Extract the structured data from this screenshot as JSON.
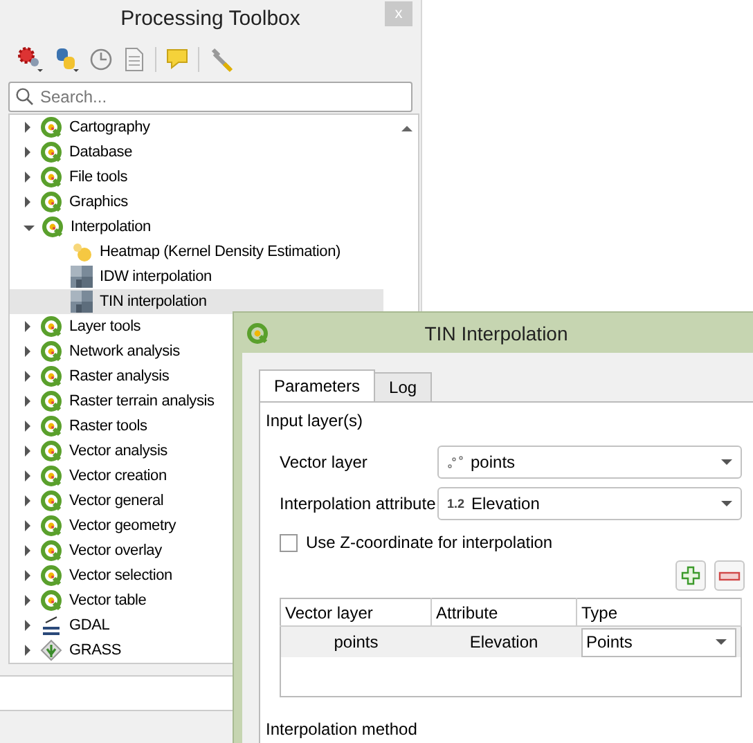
{
  "toolbox": {
    "title": "Processing Toolbox",
    "close": "x",
    "search": {
      "placeholder": "Search..."
    },
    "tree": [
      {
        "label": "Cartography",
        "kind": "qgis",
        "expanded": false
      },
      {
        "label": "Database",
        "kind": "qgis",
        "expanded": false
      },
      {
        "label": "File tools",
        "kind": "qgis",
        "expanded": false
      },
      {
        "label": "Graphics",
        "kind": "qgis",
        "expanded": false
      },
      {
        "label": "Interpolation",
        "kind": "qgis",
        "expanded": true,
        "children": [
          {
            "label": "Heatmap (Kernel Density Estimation)",
            "kind": "heatmap",
            "selected": false
          },
          {
            "label": "IDW interpolation",
            "kind": "raster",
            "selected": false
          },
          {
            "label": "TIN interpolation",
            "kind": "raster",
            "selected": true
          }
        ]
      },
      {
        "label": "Layer tools",
        "kind": "qgis",
        "expanded": false
      },
      {
        "label": "Network analysis",
        "kind": "qgis",
        "expanded": false
      },
      {
        "label": "Raster analysis",
        "kind": "qgis",
        "expanded": false
      },
      {
        "label": "Raster terrain analysis",
        "kind": "qgis",
        "expanded": false
      },
      {
        "label": "Raster tools",
        "kind": "qgis",
        "expanded": false
      },
      {
        "label": "Vector analysis",
        "kind": "qgis",
        "expanded": false
      },
      {
        "label": "Vector creation",
        "kind": "qgis",
        "expanded": false
      },
      {
        "label": "Vector general",
        "kind": "qgis",
        "expanded": false
      },
      {
        "label": "Vector geometry",
        "kind": "qgis",
        "expanded": false
      },
      {
        "label": "Vector overlay",
        "kind": "qgis",
        "expanded": false
      },
      {
        "label": "Vector selection",
        "kind": "qgis",
        "expanded": false
      },
      {
        "label": "Vector table",
        "kind": "qgis",
        "expanded": false
      },
      {
        "label": "GDAL",
        "kind": "gdal",
        "expanded": false
      },
      {
        "label": "GRASS",
        "kind": "grass",
        "expanded": false
      }
    ]
  },
  "dialog": {
    "title": "TIN Interpolation",
    "tabs": [
      {
        "label": "Parameters",
        "selected": true
      },
      {
        "label": "Log",
        "selected": false
      }
    ],
    "input_section": "Input layer(s)",
    "vector_layer": {
      "label": "Vector layer",
      "value": "points"
    },
    "interpolation_attribute": {
      "label": "Interpolation attribute",
      "type_badge": "1.2",
      "value": "Elevation"
    },
    "use_z": {
      "label": "Use Z-coordinate for interpolation",
      "checked": false
    },
    "table": {
      "columns": [
        "Vector layer",
        "Attribute",
        "Type"
      ],
      "rows": [
        {
          "cells": [
            "points",
            "Elevation",
            "Points"
          ]
        }
      ]
    },
    "method_section": "Interpolation method"
  }
}
